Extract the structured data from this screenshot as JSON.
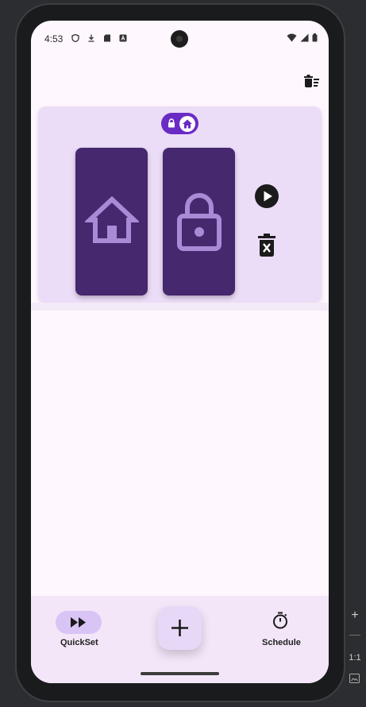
{
  "status_bar": {
    "time": "4:53",
    "icons_left": [
      "shield-icon",
      "download-icon",
      "sd-card-icon",
      "a-badge-icon"
    ],
    "icons_right": [
      "wifi-icon",
      "signal-icon",
      "battery-icon"
    ]
  },
  "toolbar": {
    "clear_all_icon": "delete-sweep-icon"
  },
  "card": {
    "mode_toggle": {
      "left_icon": "lock-icon",
      "right_icon": "home-icon",
      "state": "on"
    },
    "panels": [
      {
        "icon": "home-icon",
        "color": "#45286d"
      },
      {
        "icon": "lock-icon",
        "color": "#45286d"
      }
    ],
    "actions": {
      "play_icon": "play-circle-icon",
      "delete_icon": "delete-forever-icon"
    }
  },
  "bottom_nav": {
    "items": [
      {
        "label": "QuickSet",
        "icon": "fast-forward-icon",
        "selected": true
      },
      {
        "label": "Schedule",
        "icon": "timer-icon",
        "selected": false
      }
    ],
    "fab_icon": "plus-icon"
  },
  "ide_side": {
    "zoom_label": "1:1"
  },
  "colors": {
    "accent": "#6a2bc4",
    "panel": "#45286d",
    "card": "#ebdcf7",
    "icon_tint": "#a98ad7"
  }
}
